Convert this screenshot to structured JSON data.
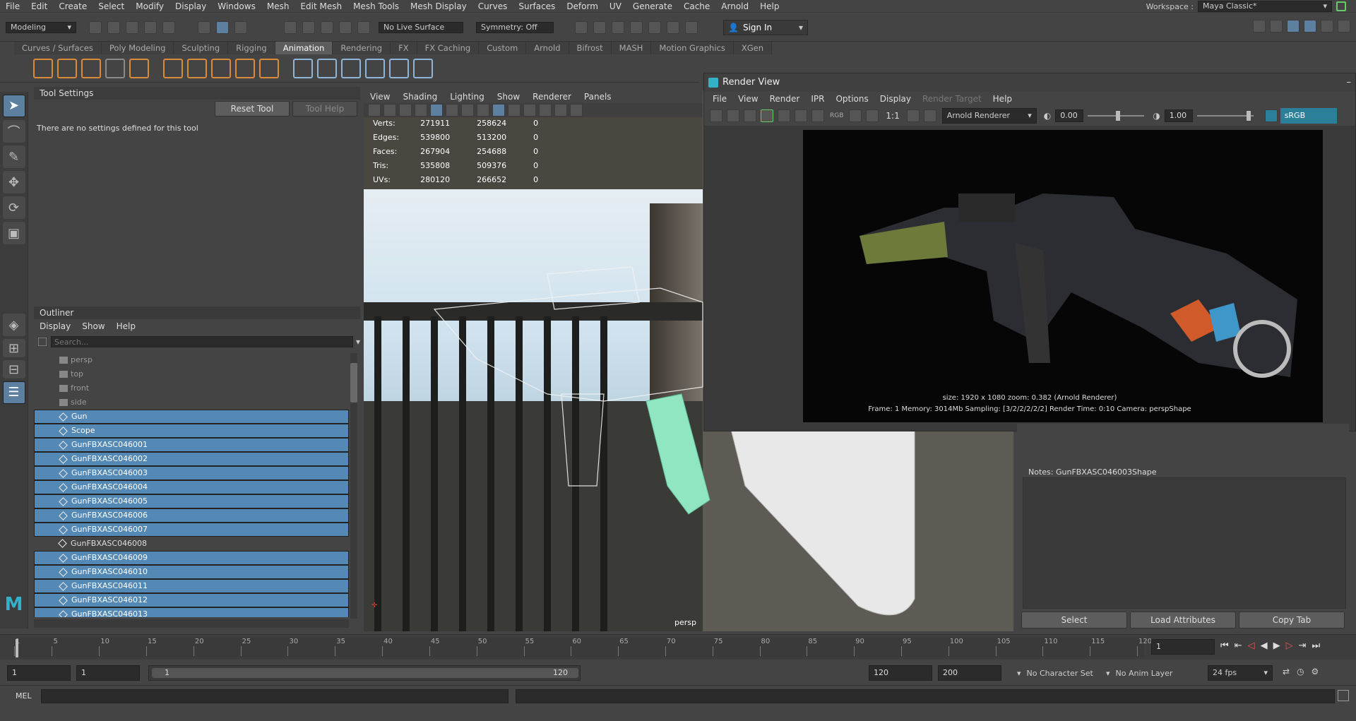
{
  "menubar": {
    "items": [
      "File",
      "Edit",
      "Create",
      "Select",
      "Modify",
      "Display",
      "Windows",
      "Mesh",
      "Edit Mesh",
      "Mesh Tools",
      "Mesh Display",
      "Curves",
      "Surfaces",
      "Deform",
      "UV",
      "Generate",
      "Cache",
      "Arnold",
      "Help"
    ],
    "workspace_label": "Workspace :",
    "workspace_value": "Maya Classic*"
  },
  "statusline": {
    "menuset": "Modeling",
    "live_surface": "No Live Surface",
    "symmetry": "Symmetry: Off",
    "sign_in": "Sign In"
  },
  "shelf": {
    "tabs": [
      "Curves / Surfaces",
      "Poly Modeling",
      "Sculpting",
      "Rigging",
      "Animation",
      "Rendering",
      "FX",
      "FX Caching",
      "Custom",
      "Arnold",
      "Bifrost",
      "MASH",
      "Motion Graphics",
      "XGen"
    ],
    "active_tab": "Animation"
  },
  "tool_settings": {
    "title": "Tool Settings",
    "reset_label": "Reset Tool",
    "help_label": "Tool Help",
    "message": "There are no settings defined for this tool"
  },
  "outliner": {
    "title": "Outliner",
    "menu": [
      "Display",
      "Show",
      "Help"
    ],
    "search_placeholder": "Search...",
    "items": [
      {
        "label": "persp",
        "kind": "camera",
        "selected": false
      },
      {
        "label": "top",
        "kind": "camera",
        "selected": false
      },
      {
        "label": "front",
        "kind": "camera",
        "selected": false
      },
      {
        "label": "side",
        "kind": "camera",
        "selected": false
      },
      {
        "label": "Gun",
        "kind": "mesh",
        "selected": true
      },
      {
        "label": "Scope",
        "kind": "mesh",
        "selected": true
      },
      {
        "label": "GunFBXASC046001",
        "kind": "mesh",
        "selected": true
      },
      {
        "label": "GunFBXASC046002",
        "kind": "mesh",
        "selected": true
      },
      {
        "label": "GunFBXASC046003",
        "kind": "mesh",
        "selected": true
      },
      {
        "label": "GunFBXASC046004",
        "kind": "mesh",
        "selected": true
      },
      {
        "label": "GunFBXASC046005",
        "kind": "mesh",
        "selected": true
      },
      {
        "label": "GunFBXASC046006",
        "kind": "mesh",
        "selected": true
      },
      {
        "label": "GunFBXASC046007",
        "kind": "mesh",
        "selected": true
      },
      {
        "label": "GunFBXASC046008",
        "kind": "mesh",
        "selected": false
      },
      {
        "label": "GunFBXASC046009",
        "kind": "mesh",
        "selected": true
      },
      {
        "label": "GunFBXASC046010",
        "kind": "mesh",
        "selected": true
      },
      {
        "label": "GunFBXASC046011",
        "kind": "mesh",
        "selected": true
      },
      {
        "label": "GunFBXASC046012",
        "kind": "mesh",
        "selected": true
      },
      {
        "label": "GunFBXASC046013",
        "kind": "mesh",
        "selected": true
      }
    ]
  },
  "viewport": {
    "menu": [
      "View",
      "Shading",
      "Lighting",
      "Show",
      "Renderer",
      "Panels"
    ],
    "camera_label": "persp",
    "hud": [
      {
        "label": "Verts:",
        "a": "271911",
        "b": "258624",
        "c": "0"
      },
      {
        "label": "Edges:",
        "a": "539800",
        "b": "513200",
        "c": "0"
      },
      {
        "label": "Faces:",
        "a": "267904",
        "b": "254688",
        "c": "0"
      },
      {
        "label": "Tris:",
        "a": "535808",
        "b": "509376",
        "c": "0"
      },
      {
        "label": "UVs:",
        "a": "280120",
        "b": "266652",
        "c": "0"
      }
    ]
  },
  "render_view": {
    "title": "Render View",
    "menu": [
      "File",
      "View",
      "Render",
      "IPR",
      "Options",
      "Display",
      "Render Target",
      "Help"
    ],
    "disabled_menu": "Render Target",
    "ratio_label": "1:1",
    "rgb_label": "RGB",
    "renderer": "Arnold Renderer",
    "exposure": "0.00",
    "gamma": "1.00",
    "color_space": "sRGB gamma",
    "info_line1": "size: 1920 x 1080 zoom: 0.382     (Arnold Renderer)",
    "info_line2": "Frame: 1     Memory: 3014Mb     Sampling: [3/2/2/2/2/2]     Render Time: 0:10     Camera: perspShape"
  },
  "attribute_editor": {
    "notes_label": "Notes:  GunFBXASC046003Shape",
    "buttons": [
      "Select",
      "Load Attributes",
      "Copy Tab"
    ]
  },
  "time_slider": {
    "ticks": [
      "1",
      "5",
      "10",
      "15",
      "20",
      "25",
      "30",
      "35",
      "40",
      "45",
      "50",
      "55",
      "60",
      "65",
      "70",
      "75",
      "80",
      "85",
      "90",
      "95",
      "100",
      "105",
      "110",
      "115",
      "120"
    ],
    "current_frame": "1"
  },
  "range_slider": {
    "start": "1",
    "playback_start": "1",
    "range_left": "1",
    "range_right": "120",
    "playback_end": "120",
    "end": "200",
    "character_set": "No Character Set",
    "anim_layer": "No Anim Layer",
    "fps": "24 fps"
  },
  "command_line": {
    "label": "MEL"
  }
}
